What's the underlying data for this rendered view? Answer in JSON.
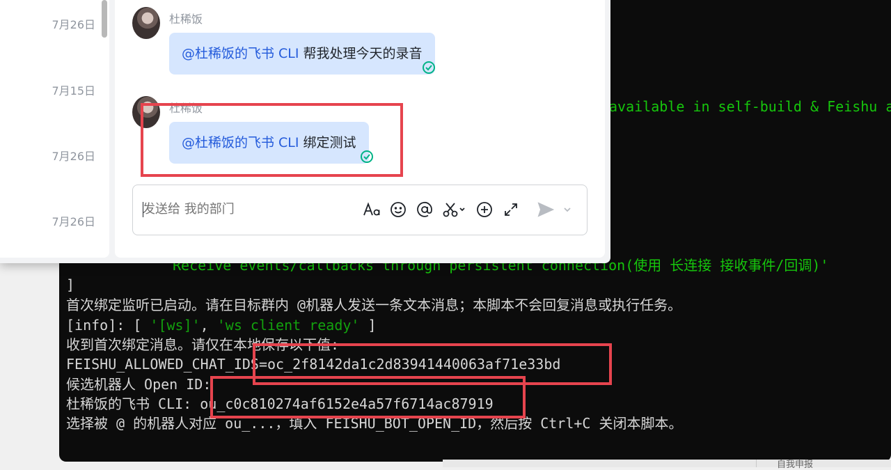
{
  "sidebar": {
    "dates": [
      "7月26日",
      "7月15日",
      "7月26日",
      "7月26日"
    ]
  },
  "chat": {
    "messages": [
      {
        "sender": "杜稀饭",
        "mention": "@杜稀饭的飞书 CLI",
        "text": " 帮我处理今天的录音"
      },
      {
        "sender": "杜稀饭",
        "mention": "@杜稀饭的飞书 CLI",
        "text": " 绑定测试"
      }
    ],
    "input": {
      "placeholder": "发送给 我的部门"
    }
  },
  "terminal": {
    "partial_top": "available in self-build & Feishu ap",
    "partial_mid": "Receive events/callbacks through persistent connection(使用 长连接 接收事件/回调)'",
    "lines": [
      "]",
      "首次绑定监听已启动。请在目标群内 @机器人发送一条文本消息；本脚本不会回复消息或执行任务。"
    ],
    "info": {
      "prefix": "[info]: [ ",
      "str1": "'[ws]'",
      "sep": ", ",
      "str2": "'ws client ready'",
      "suffix": " ]"
    },
    "line_received": "收到首次绑定消息。请仅在本地保存以下值:",
    "line_chat_ids": "FEISHU_ALLOWED_CHAT_IDS=oc_2f8142da1c2d83941440063af71e33bd",
    "line_candidate": "候选机器人 Open ID:",
    "line_bot": "杜稀饭的飞书 CLI: ou_c0c810274af6152e4a57f6714ac87919",
    "line_select": "选择被 @ 的机器人对应 ou_...，填入 FEISHU_BOT_OPEN_ID，然后按 Ctrl+C 关闭本脚本。"
  },
  "taskbar": {
    "hint": "自我申报"
  },
  "colors": {
    "terminal_bg": "#0c0c0c",
    "terminal_green": "#16c60c",
    "bubble_bg": "#d6e6fe",
    "mention": "#245bdb",
    "highlight": "#e6444e",
    "read_check": "#00b386"
  }
}
